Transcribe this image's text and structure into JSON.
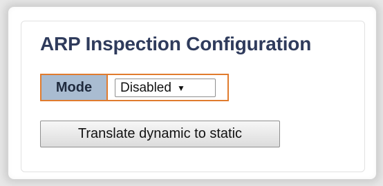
{
  "page": {
    "title": "ARP Inspection Configuration"
  },
  "mode": {
    "label": "Mode",
    "selected": "Disabled",
    "dropdown_icon": "triangle-down-icon"
  },
  "actions": {
    "translate_label": "Translate dynamic to static"
  },
  "colors": {
    "title": "#2f3b5c",
    "label_bg": "#a9bcd1",
    "highlight_border": "#e07b2d"
  }
}
